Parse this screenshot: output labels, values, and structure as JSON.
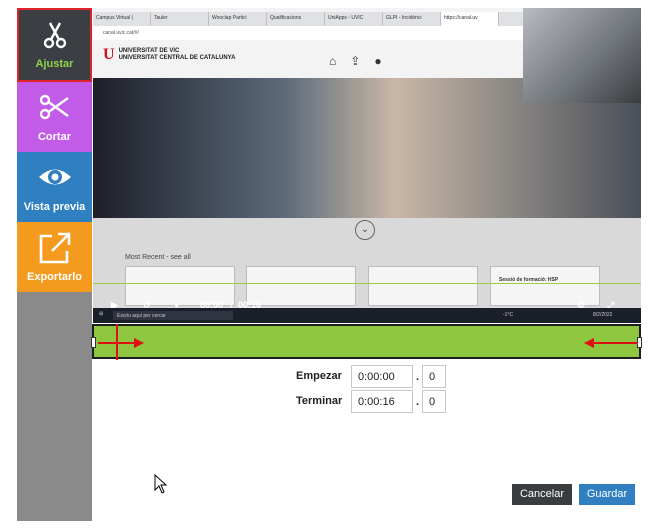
{
  "tools": [
    {
      "label": "Ajustar",
      "icon": "scissors-icon"
    },
    {
      "label": "Cortar",
      "icon": "scissors-icon"
    },
    {
      "label": "Vista previa",
      "icon": "eye-icon"
    },
    {
      "label": "Exportarlo",
      "icon": "export-icon"
    }
  ],
  "video": {
    "browser_tabs": [
      "Campus Virtual |",
      "Tauler",
      "Wooclap Partici",
      "Qualificacions",
      "UniApps - UVIC",
      "GLPI - Incidènci",
      "https://canal.uv"
    ],
    "address": "canal.uvic.cat/#/",
    "university_line1": "UNIVERSITAT DE VIC",
    "university_line2": "UNIVERSITAT CENTRAL DE CATALUNYA",
    "most_recent": "Most Recent - see all",
    "card_title": "Sessió de formació: HSP",
    "time_current": "00:00",
    "time_separator": "/",
    "time_total": "00:16",
    "taskbar_search": "Escriu aquí per cercar",
    "taskbar_temp": "-1°C",
    "taskbar_date": "8/2/2022"
  },
  "form": {
    "start_label": "Empezar",
    "start_time": "0:00:00",
    "start_frame": "0",
    "end_label": "Terminar",
    "end_time": "0:00:16",
    "end_frame": "0",
    "separator": "."
  },
  "buttons": {
    "cancel": "Cancelar",
    "save": "Guardar"
  },
  "colors": {
    "ajustar_bg": "#3b3f43",
    "ajustar_text": "#8ed44b",
    "cortar_bg": "#c25be8",
    "vista_bg": "#2f7fc1",
    "export_bg": "#f39a1f",
    "trim_bar": "#8ec63f",
    "selection_border": "#e0232a"
  }
}
